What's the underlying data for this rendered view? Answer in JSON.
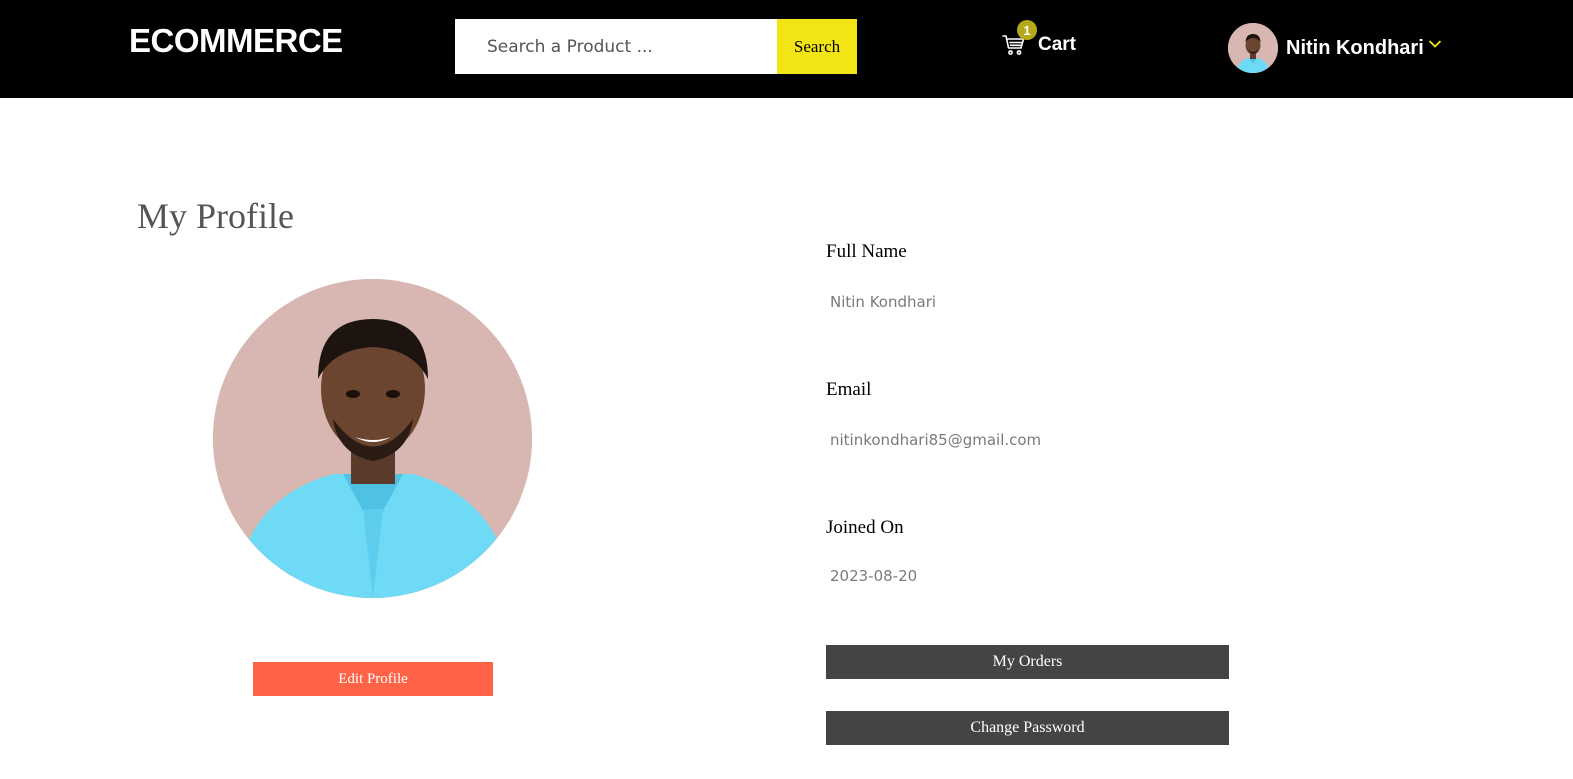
{
  "header": {
    "logo": "ECOMMERCE",
    "search": {
      "placeholder": "Search a Product ...",
      "button_label": "Search"
    },
    "cart": {
      "label": "Cart",
      "count": "1",
      "icon": "cart-icon"
    },
    "user": {
      "name": "Nitin Kondhari",
      "avatar": "user-avatar",
      "dropdown_icon": "chevron-down-icon"
    }
  },
  "profile": {
    "title": "My Profile",
    "edit_button": "Edit Profile",
    "fields": [
      {
        "label": "Full Name",
        "value": "Nitin Kondhari"
      },
      {
        "label": "Email",
        "value": "nitinkondhari85@gmail.com"
      },
      {
        "label": "Joined On",
        "value": "2023-08-20"
      }
    ],
    "actions": {
      "orders": "My Orders",
      "change_password": "Change Password"
    }
  },
  "colors": {
    "navbar_bg": "#000000",
    "search_button": "#f2e415",
    "cart_badge": "#b5a81a",
    "chevron": "#f2e415",
    "edit_button": "#ff6347",
    "action_button": "#444444",
    "avatar_bg": "#d8b7b2",
    "shirt": "#6fdaf5"
  }
}
